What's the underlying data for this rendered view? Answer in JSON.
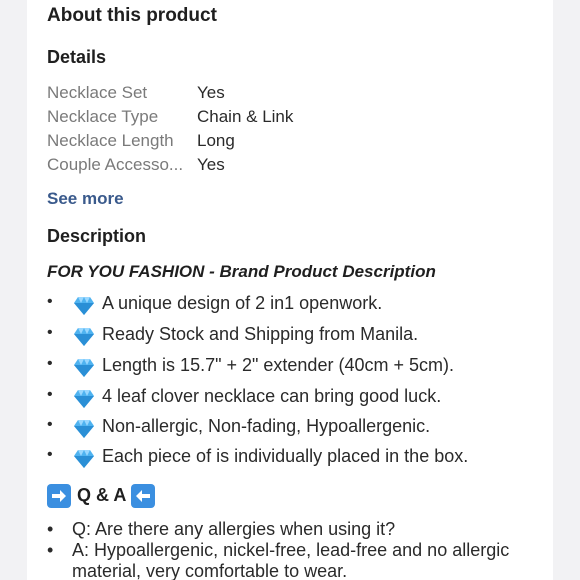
{
  "section_title": "About this product",
  "details": {
    "heading": "Details",
    "rows": [
      {
        "label": "Necklace Set",
        "value": "Yes"
      },
      {
        "label": "Necklace Type",
        "value": "Chain & Link"
      },
      {
        "label": "Necklace Length",
        "value": "Long"
      },
      {
        "label": "Couple Accesso...",
        "value": "Yes"
      }
    ],
    "see_more": "See more"
  },
  "description": {
    "heading": "Description",
    "title": "FOR YOU FASHION - Brand Product Description",
    "bullet_symbol": "•",
    "bullet_icon": "gem-icon",
    "bullets": [
      "A unique design of 2 in1 openwork.",
      "Ready Stock and Shipping from Manila.",
      "Length is 15.7\" + 2\" extender (40cm + 5cm).",
      "4 leaf clover necklace can bring good luck.",
      "Non-allergic, Non-fading, Hypoallergenic.",
      "Each piece of is individually placed in the box."
    ]
  },
  "qa": {
    "title": "Q & A",
    "left_icon": "arrow-right-icon",
    "right_icon": "arrow-left-icon",
    "items": [
      "Q: Are there any allergies when using it?",
      "A: Hypoallergenic, nickel-free, lead-free and no allergic material, very comfortable to wear."
    ]
  },
  "colors": {
    "link": "#3a5a8c",
    "gem": "#4fb3f0",
    "arrow_box": "#3b8fe0"
  }
}
